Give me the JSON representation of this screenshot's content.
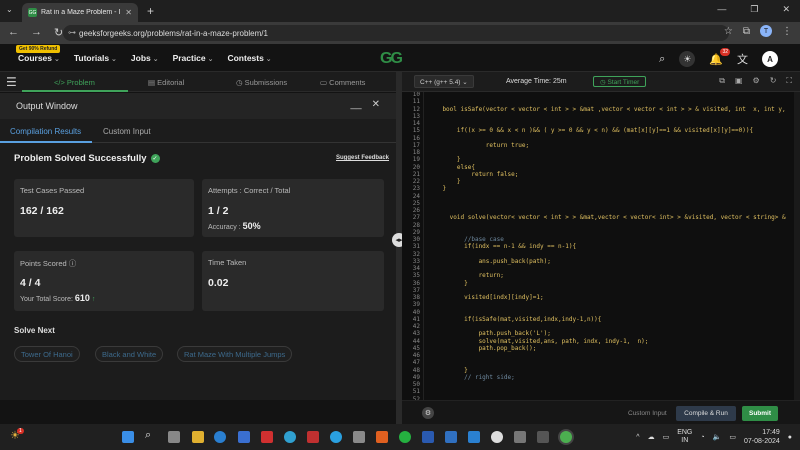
{
  "browser": {
    "tab_title": "Rat in a Maze Problem - I | Pra",
    "url": "geeksforgeeks.org/problems/rat-in-a-maze-problem/1",
    "profile_initial": "T"
  },
  "gfg_nav": {
    "refund_badge": "Get 90% Refund",
    "items": [
      "Courses",
      "Tutorials",
      "Jobs",
      "Practice",
      "Contests"
    ],
    "logo": "GG",
    "notif_count": "32",
    "avatar": "A"
  },
  "left_tabs": [
    "</> Problem",
    "Editorial",
    "Submissions",
    "Comments"
  ],
  "output": {
    "title": "Output Window",
    "minimize": "__",
    "close": "✕",
    "tabs": [
      "Compilation Results",
      "Custom Input"
    ],
    "status": "Problem Solved Successfully",
    "feedback": "Suggest Feedback",
    "cards": {
      "test_cases_label": "Test Cases Passed",
      "test_cases_value": "162 / 162",
      "attempts_label": "Attempts : Correct / Total",
      "attempts_value": "1 / 2",
      "accuracy_label": "Accuracy :",
      "accuracy_value": "50%",
      "points_label": "Points Scored",
      "points_value": "4 / 4",
      "total_label": "Your Total Score:",
      "total_value": "610",
      "time_label": "Time Taken",
      "time_value": "0.02"
    },
    "solve_next_label": "Solve Next",
    "solve_next": [
      "Tower Of Hanoi",
      "Black and White",
      "Rat Maze With Multiple Jumps"
    ]
  },
  "editor_header": {
    "language": "C++ (g++ 5.4)",
    "avg_time": "Average Time: 25m",
    "timer": "Start Timer"
  },
  "code_lines": [
    {
      "n": "10",
      "t": ""
    },
    {
      "n": "11",
      "t": ""
    },
    {
      "n": "12",
      "t": "    bool isSafe(vector < vector < int > > &mat ,vector < vector < int > > & visited, int  x, int y,"
    },
    {
      "n": "13",
      "t": ""
    },
    {
      "n": "14",
      "t": ""
    },
    {
      "n": "15",
      "t": "        if((x >= 0 && x < n )&& ( y >= 0 && y < n) && (mat[x][y]==1 && visited[x][y]==0)){"
    },
    {
      "n": "16",
      "t": ""
    },
    {
      "n": "17",
      "t": "                return true;"
    },
    {
      "n": "18",
      "t": ""
    },
    {
      "n": "19",
      "t": "        }"
    },
    {
      "n": "20",
      "t": "        else{"
    },
    {
      "n": "21",
      "t": "            return false;"
    },
    {
      "n": "22",
      "t": "        }"
    },
    {
      "n": "23",
      "t": "    }"
    },
    {
      "n": "24",
      "t": ""
    },
    {
      "n": "25",
      "t": ""
    },
    {
      "n": "26",
      "t": ""
    },
    {
      "n": "27",
      "t": "      void solve(vector< vector < int > > &mat,vector < vector< int> > &visited, vector < string> &"
    },
    {
      "n": "28",
      "t": ""
    },
    {
      "n": "29",
      "t": ""
    },
    {
      "n": "30",
      "t": "          //base case"
    },
    {
      "n": "31",
      "t": "          if(indx == n-1 && indy == n-1){"
    },
    {
      "n": "32",
      "t": ""
    },
    {
      "n": "33",
      "t": "              ans.push_back(path);"
    },
    {
      "n": "34",
      "t": ""
    },
    {
      "n": "35",
      "t": "              return;"
    },
    {
      "n": "36",
      "t": "          }"
    },
    {
      "n": "37",
      "t": ""
    },
    {
      "n": "38",
      "t": "          visited[indx][indy]=1;"
    },
    {
      "n": "39",
      "t": ""
    },
    {
      "n": "40",
      "t": ""
    },
    {
      "n": "41",
      "t": "          if(isSafe(mat,visited,indx,indy-1,n)){"
    },
    {
      "n": "42",
      "t": ""
    },
    {
      "n": "43",
      "t": "              path.push_back('L');"
    },
    {
      "n": "44",
      "t": "              solve(mat,visited,ans, path, indx, indy-1,  n);"
    },
    {
      "n": "45",
      "t": "              path.pop_back();"
    },
    {
      "n": "46",
      "t": ""
    },
    {
      "n": "47",
      "t": ""
    },
    {
      "n": "48",
      "t": "          }"
    },
    {
      "n": "49",
      "t": "          // right side;"
    },
    {
      "n": "50",
      "t": ""
    },
    {
      "n": "51",
      "t": ""
    },
    {
      "n": "52",
      "t": ""
    }
  ],
  "editor_footer": {
    "custom_input": "Custom Input",
    "compile": "Compile & Run",
    "submit": "Submit"
  },
  "taskbar": {
    "weather_badge": "1",
    "lang_top": "ENG",
    "lang_bottom": "IN",
    "time": "17:49",
    "date": "07-08-2024"
  },
  "colors": {
    "gfg_green": "#2f8d46",
    "accent_blue": "#5aa0e0",
    "code_yellow": "#e0c060",
    "comment_grey": "#6f8aa0",
    "keyword": "#e0c060"
  }
}
